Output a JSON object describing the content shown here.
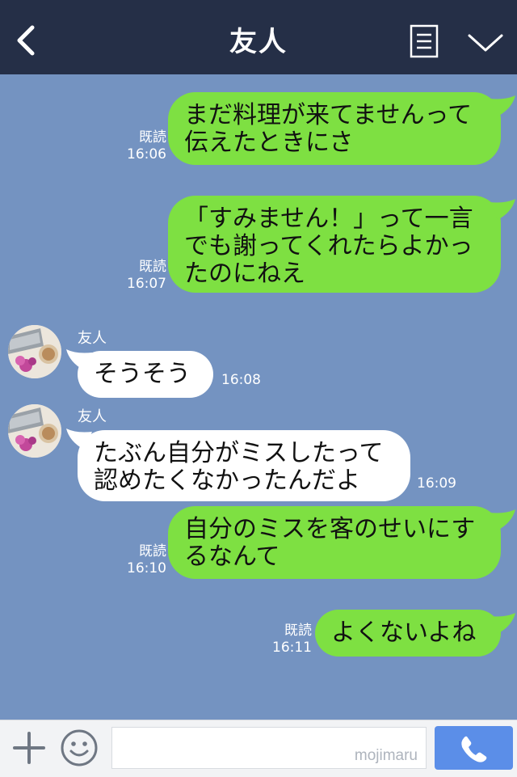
{
  "header": {
    "title": "友人",
    "back_icon": "chevron-left-icon",
    "note_icon": "note-icon",
    "menu_icon": "chevron-down-icon"
  },
  "messages": [
    {
      "side": "right",
      "text": "まだ料理が来てませんって\n伝えたときにさ",
      "read": "既読",
      "time": "16:06"
    },
    {
      "side": "right",
      "text": "「すみません！」って一言\nでも謝ってくれたらよかっ\nたのにねえ",
      "read": "既読",
      "time": "16:07"
    },
    {
      "side": "left",
      "sender": "友人",
      "text": "そうそう",
      "time": "16:08"
    },
    {
      "side": "left",
      "sender": "友人",
      "text": "たぶん自分がミスしたって\n認めたくなかったんだよ",
      "time": "16:09"
    },
    {
      "side": "right",
      "text": "自分のミスを客のせいにす\nるなんて",
      "read": "既読",
      "time": "16:10"
    },
    {
      "side": "right",
      "text": "よくないよね",
      "read": "既読",
      "time": "16:11"
    }
  ],
  "footer": {
    "plus_icon": "plus-icon",
    "emoji_icon": "smiley-icon",
    "input_value": "",
    "watermark": "mojimaru",
    "call_icon": "phone-icon"
  },
  "colors": {
    "background": "#7493c1",
    "header": "#252f47",
    "sent_bubble": "#7ee042",
    "received_bubble": "#ffffff",
    "call_button": "#5b8ee8"
  }
}
